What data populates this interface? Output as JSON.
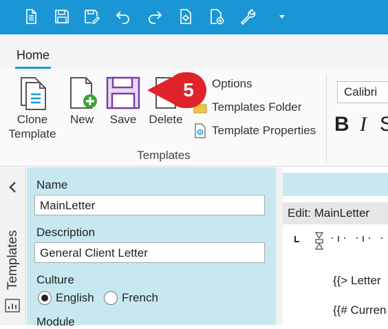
{
  "quick_access": {
    "icons": [
      "new-document-icon",
      "save-icon",
      "save-edit-icon",
      "undo-icon",
      "redo-icon",
      "template-settings-icon",
      "new-template-icon",
      "wrench-icon",
      "dropdown-arrow-icon"
    ]
  },
  "tabs": {
    "home": "Home"
  },
  "ribbon": {
    "clone_template": "Clone\nTemplate",
    "new": "New",
    "save": "Save",
    "delete": "Delete",
    "options": "Options",
    "templates_folder": "Templates Folder",
    "template_properties": "Template Properties",
    "group_label": "Templates",
    "font": "Calibri",
    "bold": "B",
    "italic": "I",
    "strike": "S"
  },
  "callout": {
    "number": "5",
    "color": "#e0232b"
  },
  "sidebar": {
    "label": "Templates"
  },
  "form": {
    "name_label": "Name",
    "name_value": "MainLetter",
    "description_label": "Description",
    "description_value": "General Client Letter",
    "culture_label": "Culture",
    "culture_options": [
      "English",
      "French"
    ],
    "culture_selected": "English",
    "module_label": "Module"
  },
  "editor": {
    "header": "Edit: MainLetter",
    "lines": [
      "{{> Letter",
      "{{# Curren"
    ]
  },
  "colors": {
    "accent": "#1b96d4",
    "panel": "#c7e8f0",
    "save_purple": "#7a3ea6"
  }
}
